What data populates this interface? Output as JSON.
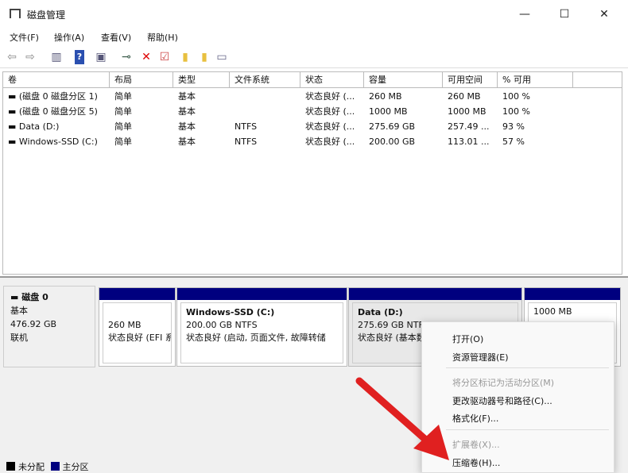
{
  "window": {
    "title": "磁盘管理",
    "minimize": "—",
    "maximize": "☐",
    "close": "✕"
  },
  "menu": [
    "文件(F)",
    "操作(A)",
    "查看(V)",
    "帮助(H)"
  ],
  "toolbar": [
    "back-icon",
    "forward-icon",
    "console-tree-icon",
    "help-icon",
    "properties-icon",
    "connect-icon",
    "delete-icon",
    "check-icon",
    "folder-up-icon",
    "folder-search-icon",
    "list-icon"
  ],
  "table": {
    "headers": [
      "卷",
      "布局",
      "类型",
      "文件系统",
      "状态",
      "容量",
      "可用空间",
      "% 可用"
    ],
    "rows": [
      [
        "(磁盘 0 磁盘分区 1)",
        "简单",
        "基本",
        "",
        "状态良好 (...",
        "260 MB",
        "260 MB",
        "100 %"
      ],
      [
        "(磁盘 0 磁盘分区 5)",
        "简单",
        "基本",
        "",
        "状态良好 (...",
        "1000 MB",
        "1000 MB",
        "100 %"
      ],
      [
        "Data (D:)",
        "简单",
        "基本",
        "NTFS",
        "状态良好 (...",
        "275.69 GB",
        "257.49 ...",
        "93 %"
      ],
      [
        "Windows-SSD (C:)",
        "简单",
        "基本",
        "NTFS",
        "状态良好 (...",
        "200.00 GB",
        "113.01 ...",
        "57 %"
      ]
    ]
  },
  "disk": {
    "name": "磁盘 0",
    "type": "基本",
    "size": "476.92 GB",
    "status": "联机"
  },
  "partitions": [
    {
      "title": "",
      "line1": "260 MB",
      "line2": "状态良好 (EFI 系统分区)"
    },
    {
      "title": "Windows-SSD  (C:)",
      "line1": "200.00 GB NTFS",
      "line2": "状态良好 (启动, 页面文件, 故障转储"
    },
    {
      "title": "Data  (D:)",
      "line1": "275.69 GB NTFS",
      "line2": "状态良好 (基本数据分区)"
    },
    {
      "title": "",
      "line1": "1000 MB",
      "line2": ""
    }
  ],
  "context_menu": [
    {
      "label": "打开(O)",
      "enabled": true
    },
    {
      "label": "资源管理器(E)",
      "enabled": true
    },
    {
      "label": "将分区标记为活动分区(M)",
      "enabled": false
    },
    {
      "label": "更改驱动器号和路径(C)...",
      "enabled": true
    },
    {
      "label": "格式化(F)...",
      "enabled": true
    },
    {
      "label": "扩展卷(X)...",
      "enabled": false
    },
    {
      "label": "压缩卷(H)...",
      "enabled": true
    }
  ],
  "legend": [
    {
      "label": "未分配",
      "color": "#000000"
    },
    {
      "label": "主分区",
      "color": "#00007f"
    }
  ],
  "colors": {
    "partition_bar": "#00007f",
    "annotation_arrow": "#e02020"
  }
}
